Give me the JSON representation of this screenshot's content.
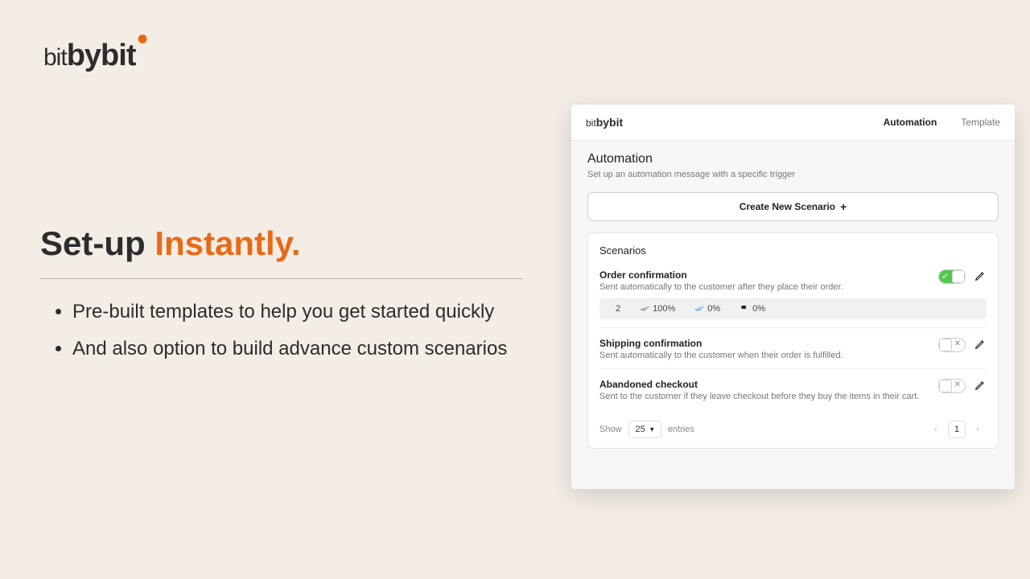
{
  "brand": {
    "part1": "bit",
    "part2": "by",
    "part3": "bit"
  },
  "headline": {
    "pre": "Set-up ",
    "accent": "Instantly."
  },
  "bullets": [
    "Pre-built templates to help you get started quickly",
    "And also option to build advance custom scenarios"
  ],
  "app": {
    "tabs": {
      "automation": "Automation",
      "template": "Template"
    },
    "page": {
      "title": "Automation",
      "subtitle": "Set up an automation message with a specific trigger"
    },
    "create_button": "Create New Scenario",
    "scenarios_title": "Scenarios",
    "scenarios": [
      {
        "name": "Order confirmation",
        "desc": "Sent automatically to the customer after they place their order.",
        "enabled": true,
        "stats": {
          "count": "2",
          "delivered": "100%",
          "read": "0%",
          "replied": "0%"
        }
      },
      {
        "name": "Shipping confirmation",
        "desc": "Sent automatically to the customer when their order is fulfilled.",
        "enabled": false
      },
      {
        "name": "Abandoned checkout",
        "desc": "Sent to the customer if they leave checkout before they buy the items in their cart.",
        "enabled": false
      }
    ],
    "pager": {
      "show": "Show",
      "size": "25",
      "entries": "entries",
      "page": "1"
    }
  }
}
